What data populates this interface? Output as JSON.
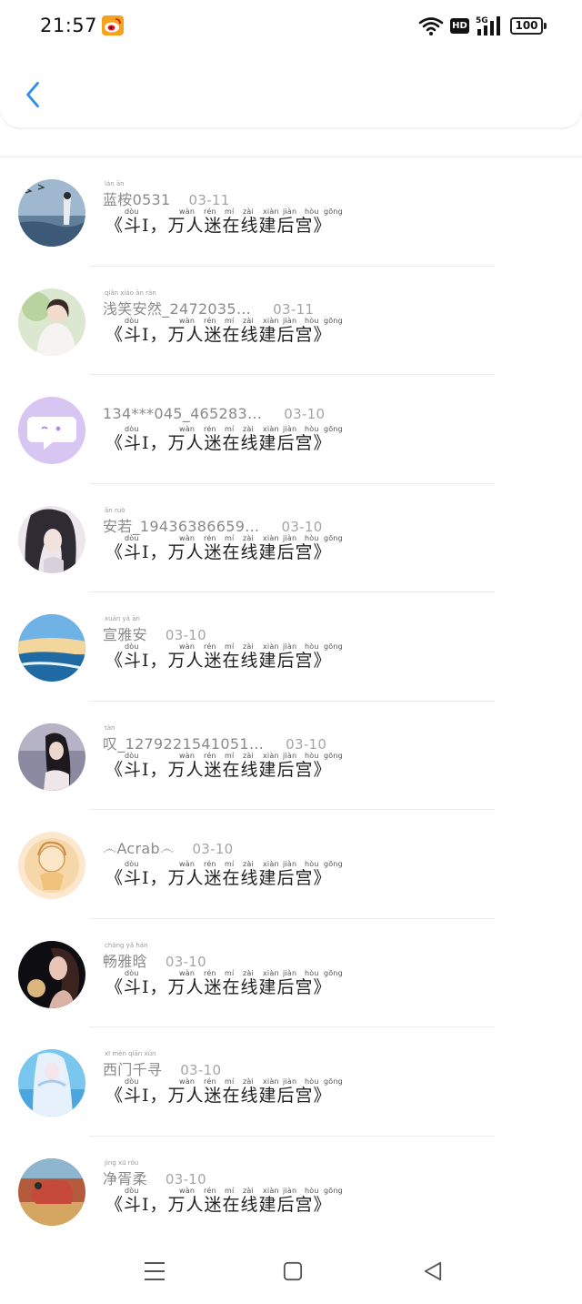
{
  "status_bar": {
    "time": "21:57",
    "hd_label": "HD",
    "network_label": "5G",
    "battery_level": "100"
  },
  "header": {
    "back_icon": "chevron-left-icon"
  },
  "comment_text": "《斗I，万人迷在线建后宫》",
  "pinyin": [
    "dòu",
    "wàn",
    "rén",
    "mí",
    "zài",
    "xiàn",
    "jiàn",
    "hòu",
    "gōng"
  ],
  "comments": [
    {
      "username": "",
      "date": "",
      "partial": true
    },
    {
      "username": "蓝桉0531",
      "date": "03-11",
      "name_pinyin": "lán ān"
    },
    {
      "username": "浅笑安然_2472035…",
      "date": "03-11",
      "name_pinyin": "qiǎn xiào ān rán"
    },
    {
      "username": "134***045_465283…",
      "date": "03-10",
      "name_pinyin": ""
    },
    {
      "username": "安若_19436386659…",
      "date": "03-10",
      "name_pinyin": "ān ruò"
    },
    {
      "username": "宣雅安",
      "date": "03-10",
      "name_pinyin": "xuān yǎ ān"
    },
    {
      "username": "叹_1279221541051…",
      "date": "03-10",
      "name_pinyin": "tàn"
    },
    {
      "username": "෴Acrab෴",
      "date": "03-10",
      "name_pinyin": ""
    },
    {
      "username": "畅雅晗",
      "date": "03-10",
      "name_pinyin": "chàng yǎ hán"
    },
    {
      "username": "西门千寻",
      "date": "03-10",
      "name_pinyin": "xī mén qiān xún"
    },
    {
      "username": "净胥柔",
      "date": "03-10",
      "name_pinyin": "jìng xū róu"
    }
  ],
  "nav": {
    "menu_icon": "menu-icon",
    "home_icon": "home-square-icon",
    "back_icon": "back-triangle-icon"
  }
}
